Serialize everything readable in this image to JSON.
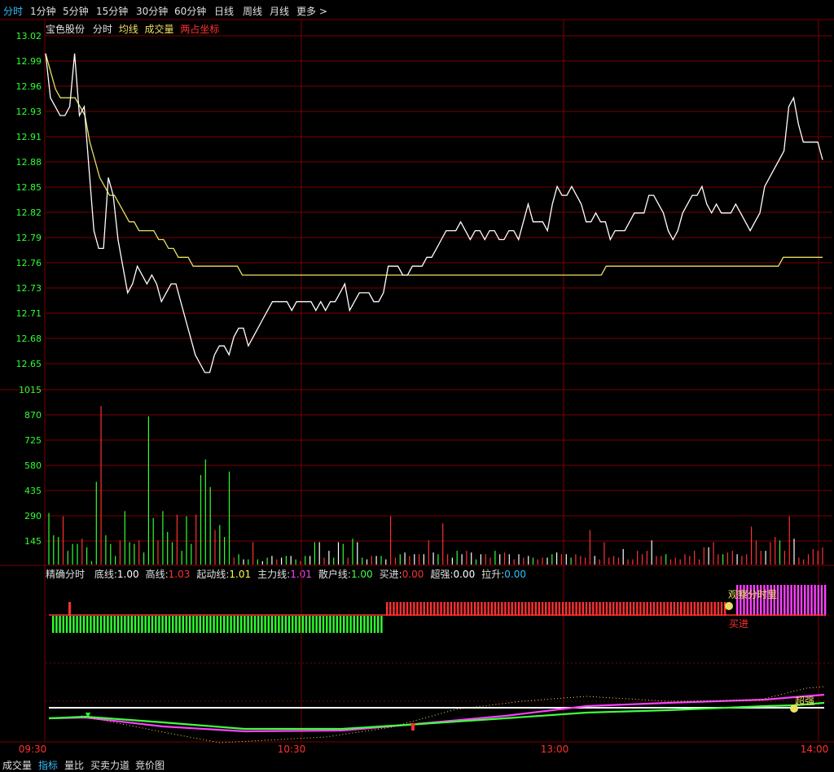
{
  "timeframe_tabs": [
    "分时",
    "1分钟",
    "5分钟",
    "15分钟",
    "30分钟",
    "60分钟",
    "日线",
    "周线",
    "月线",
    "更多 >"
  ],
  "active_tab": "分时",
  "price_header": {
    "stock": "宝色股份",
    "mode": "分时",
    "avg_label": "均线",
    "volume_label": "成交量",
    "coord_label": "两占坐标"
  },
  "indicator_header": {
    "name": "精确分时",
    "items": [
      {
        "label": "底线:",
        "value": "1.00",
        "color": "#ffffff"
      },
      {
        "label": "高线:",
        "value": "1.03",
        "color": "#ff3030"
      },
      {
        "label": "起动线:",
        "value": "1.01",
        "color": "#ffff40"
      },
      {
        "label": "主力线:",
        "value": "1.01",
        "color": "#ff40ff"
      },
      {
        "label": "散户线:",
        "value": "1.00",
        "color": "#40ff40"
      },
      {
        "label": "买进:",
        "value": "0.00",
        "color": "#ff3030"
      },
      {
        "label": "超强:",
        "value": "0.00",
        "color": "#ffffff"
      },
      {
        "label": "拉升:",
        "value": "0.00",
        "color": "#30c0ff"
      }
    ]
  },
  "signals": {
    "watch": "观察分时里",
    "buy": "买进",
    "strong": "超强"
  },
  "time_axis": [
    "09:30",
    "10:30",
    "13:00",
    "14:00"
  ],
  "bottom_tabs": [
    "成交量",
    "指标",
    "量比",
    "买卖力道",
    "竞价图"
  ],
  "active_bottom_tab": "指标",
  "colors": {
    "up": "#ff3030",
    "down": "#30ff30",
    "grid": "#7a0000",
    "price": "#ffffff",
    "avg": "#e8e060",
    "main": "#ff40ff",
    "retail": "#40ff40"
  },
  "chart_data": [
    {
      "type": "line",
      "title": "宝色股份 分时",
      "y_ticks": [
        "13.02",
        "12.99",
        "12.96",
        "12.93",
        "12.91",
        "12.88",
        "12.85",
        "12.82",
        "12.79",
        "12.76",
        "12.73",
        "12.71",
        "12.68",
        "12.65"
      ],
      "ylim": [
        12.63,
        13.02
      ],
      "x_labels": [
        "09:30",
        "10:30",
        "13:00",
        "14:00"
      ],
      "series": [
        {
          "name": "分时",
          "values": [
            13.0,
            12.95,
            12.94,
            12.93,
            12.93,
            12.94,
            13.0,
            12.93,
            12.94,
            12.87,
            12.8,
            12.78,
            12.78,
            12.86,
            12.84,
            12.79,
            12.76,
            12.73,
            12.74,
            12.76,
            12.75,
            12.74,
            12.75,
            12.74,
            12.72,
            12.73,
            12.74,
            12.74,
            12.72,
            12.7,
            12.68,
            12.66,
            12.65,
            12.64,
            12.64,
            12.66,
            12.67,
            12.67,
            12.66,
            12.68,
            12.69,
            12.69,
            12.67,
            12.68,
            12.69,
            12.7,
            12.71,
            12.72,
            12.72,
            12.72,
            12.72,
            12.71,
            12.72,
            12.72,
            12.72,
            12.72,
            12.71,
            12.72,
            12.71,
            12.72,
            12.72,
            12.73,
            12.74,
            12.71,
            12.72,
            12.73,
            12.73,
            12.73,
            12.72,
            12.72,
            12.73,
            12.76,
            12.76,
            12.76,
            12.75,
            12.75,
            12.76,
            12.76,
            12.76,
            12.77,
            12.77,
            12.78,
            12.79,
            12.8,
            12.8,
            12.8,
            12.81,
            12.8,
            12.79,
            12.8,
            12.8,
            12.79,
            12.8,
            12.8,
            12.79,
            12.79,
            12.8,
            12.8,
            12.79,
            12.81,
            12.83,
            12.81,
            12.81,
            12.81,
            12.8,
            12.83,
            12.85,
            12.84,
            12.84,
            12.85,
            12.84,
            12.83,
            12.81,
            12.81,
            12.82,
            12.81,
            12.81,
            12.79,
            12.8,
            12.8,
            12.8,
            12.81,
            12.82,
            12.82,
            12.82,
            12.84,
            12.84,
            12.83,
            12.82,
            12.8,
            12.79,
            12.8,
            12.82,
            12.83,
            12.84,
            12.84,
            12.85,
            12.83,
            12.82,
            12.83,
            12.82,
            12.82,
            12.82,
            12.83,
            12.82,
            12.81,
            12.8,
            12.81,
            12.82,
            12.85,
            12.86,
            12.87,
            12.88,
            12.89,
            12.94,
            12.95,
            12.92,
            12.9,
            12.9,
            12.9,
            12.9,
            12.88
          ]
        },
        {
          "name": "均线",
          "values": [
            13.0,
            12.98,
            12.96,
            12.95,
            12.95,
            12.95,
            12.95,
            12.94,
            12.93,
            12.9,
            12.88,
            12.86,
            12.85,
            12.84,
            12.84,
            12.83,
            12.82,
            12.81,
            12.81,
            12.8,
            12.8,
            12.8,
            12.8,
            12.79,
            12.79,
            12.78,
            12.78,
            12.77,
            12.77,
            12.77,
            12.76,
            12.76,
            12.76,
            12.76,
            12.76,
            12.76,
            12.76,
            12.76,
            12.76,
            12.76,
            12.75,
            12.75,
            12.75,
            12.75,
            12.75,
            12.75,
            12.75,
            12.75,
            12.75,
            12.75,
            12.75,
            12.75,
            12.75,
            12.75,
            12.75,
            12.75,
            12.75,
            12.75,
            12.75,
            12.75,
            12.75,
            12.75,
            12.75,
            12.75,
            12.75,
            12.75,
            12.75,
            12.75,
            12.75,
            12.75,
            12.75,
            12.75,
            12.75,
            12.75,
            12.75,
            12.75,
            12.75,
            12.75,
            12.75,
            12.75,
            12.75,
            12.75,
            12.75,
            12.75,
            12.75,
            12.75,
            12.75,
            12.75,
            12.75,
            12.75,
            12.75,
            12.75,
            12.75,
            12.75,
            12.75,
            12.75,
            12.75,
            12.75,
            12.75,
            12.75,
            12.75,
            12.75,
            12.75,
            12.75,
            12.75,
            12.75,
            12.75,
            12.75,
            12.75,
            12.75,
            12.75,
            12.75,
            12.75,
            12.75,
            12.76,
            12.76,
            12.76,
            12.76,
            12.76,
            12.76,
            12.76,
            12.76,
            12.76,
            12.76,
            12.76,
            12.76,
            12.76,
            12.76,
            12.76,
            12.76,
            12.76,
            12.76,
            12.76,
            12.76,
            12.76,
            12.76,
            12.76,
            12.76,
            12.76,
            12.76,
            12.76,
            12.76,
            12.76,
            12.76,
            12.76,
            12.76,
            12.76,
            12.76,
            12.76,
            12.76,
            12.77,
            12.77,
            12.77,
            12.77,
            12.77,
            12.77,
            12.77,
            12.77,
            12.77
          ]
        }
      ]
    },
    {
      "type": "bar",
      "title": "成交量",
      "y_ticks": [
        "1015",
        "870",
        "725",
        "580",
        "435",
        "290",
        "145"
      ],
      "ylim": [
        0,
        1015
      ],
      "values": [
        300,
        170,
        160,
        280,
        80,
        120,
        120,
        150,
        100,
        20,
        480,
        920,
        170,
        120,
        50,
        140,
        310,
        130,
        120,
        140,
        70,
        860,
        270,
        140,
        310,
        190,
        130,
        290,
        80,
        280,
        120,
        290,
        520,
        610,
        450,
        200,
        230,
        160,
        540,
        40,
        60,
        30,
        30,
        130,
        30,
        20,
        40,
        50,
        30,
        40,
        50,
        50,
        30,
        20,
        50,
        50,
        130,
        130,
        40,
        80,
        40,
        130,
        120,
        40,
        150,
        130,
        40,
        30,
        50,
        50,
        50,
        30,
        280,
        40,
        60,
        70,
        50,
        60,
        60,
        60,
        140,
        70,
        60,
        240,
        60,
        40,
        80,
        60,
        80,
        70,
        30,
        60,
        60,
        40,
        80,
        60,
        70,
        60,
        30,
        60,
        40,
        50,
        40,
        30,
        40,
        40,
        60,
        70,
        60,
        60,
        40,
        60,
        50,
        40,
        200,
        50,
        30,
        130,
        40,
        50,
        40,
        90,
        30,
        30,
        80,
        60,
        80,
        140,
        50,
        50,
        60,
        30,
        40,
        30,
        60,
        50,
        80,
        30,
        100,
        100,
        130,
        60,
        60,
        70,
        80,
        60,
        50,
        60,
        220,
        140,
        80,
        80,
        130,
        160,
        140,
        80,
        280,
        150,
        40,
        30,
        60,
        90,
        80,
        100
      ]
    }
  ]
}
